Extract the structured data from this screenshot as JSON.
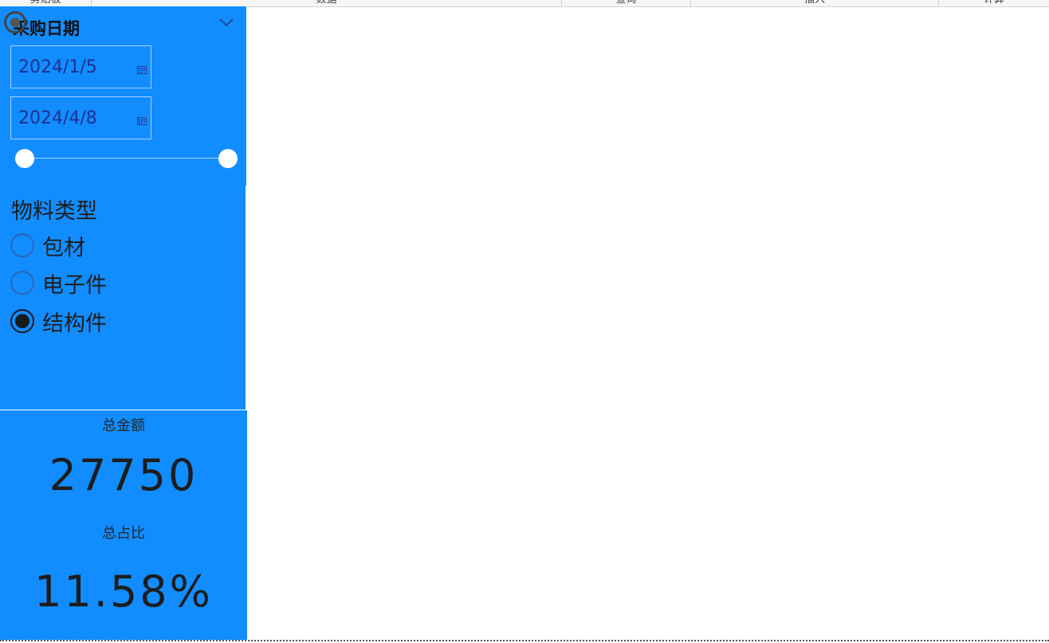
{
  "ribbon": {
    "groups": [
      "剪贴板",
      "数据",
      "查询",
      "插入",
      "计算"
    ]
  },
  "date_slicer": {
    "title": "采购日期",
    "start_date": "2024/1/5",
    "end_date": "2024/4/8",
    "range_start_fraction": 0.0,
    "range_end_fraction": 1.0,
    "icons": [
      "focus-mode-icon",
      "chevron-down-icon",
      "calendar-icon"
    ]
  },
  "type_slicer": {
    "title": "物料类型",
    "options": [
      {
        "label": "包材",
        "selected": false
      },
      {
        "label": "电子件",
        "selected": false
      },
      {
        "label": "结构件",
        "selected": true
      }
    ]
  },
  "kpi": {
    "total_amount_label": "总金额",
    "total_amount_value": "27750",
    "total_share_label": "总占比",
    "total_share_value": "11.58%"
  },
  "colors": {
    "panel_bg": "#118dff",
    "canvas_bg": "#ffffff",
    "date_text": "#1f2f90"
  }
}
